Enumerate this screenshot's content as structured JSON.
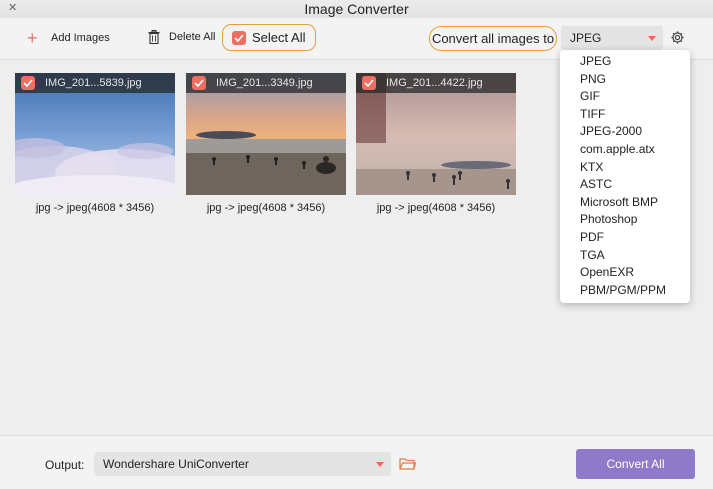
{
  "window": {
    "title": "Image Converter"
  },
  "toolbar": {
    "add_images_label": "Add Images",
    "delete_all_label": "Delete All",
    "select_all_label": "Select All",
    "convert_label": "Convert all images to",
    "format_selected": "JPEG",
    "accent_color": "#ef6e62",
    "highlight_color": "#e1a13c"
  },
  "format_options": [
    "JPEG",
    "PNG",
    "GIF",
    "TIFF",
    "JPEG-2000",
    "com.apple.atx",
    "KTX",
    "ASTC",
    "Microsoft BMP",
    "Photoshop",
    "PDF",
    "TGA",
    "OpenEXR",
    "PBM/PGM/PPM"
  ],
  "images": [
    {
      "name": "IMG_201...5839.jpg",
      "caption": "jpg -> jpeg(4608 * 3456)",
      "checked": true
    },
    {
      "name": "IMG_201...3349.jpg",
      "caption": "jpg -> jpeg(4608 * 3456)",
      "checked": true
    },
    {
      "name": "IMG_201...4422.jpg",
      "caption": "jpg -> jpeg(4608 * 3456)",
      "checked": true
    }
  ],
  "footer": {
    "output_label": "Output:",
    "output_value": "Wondershare UniConverter",
    "convert_all_label": "Convert All",
    "button_color": "#8f79c9"
  }
}
